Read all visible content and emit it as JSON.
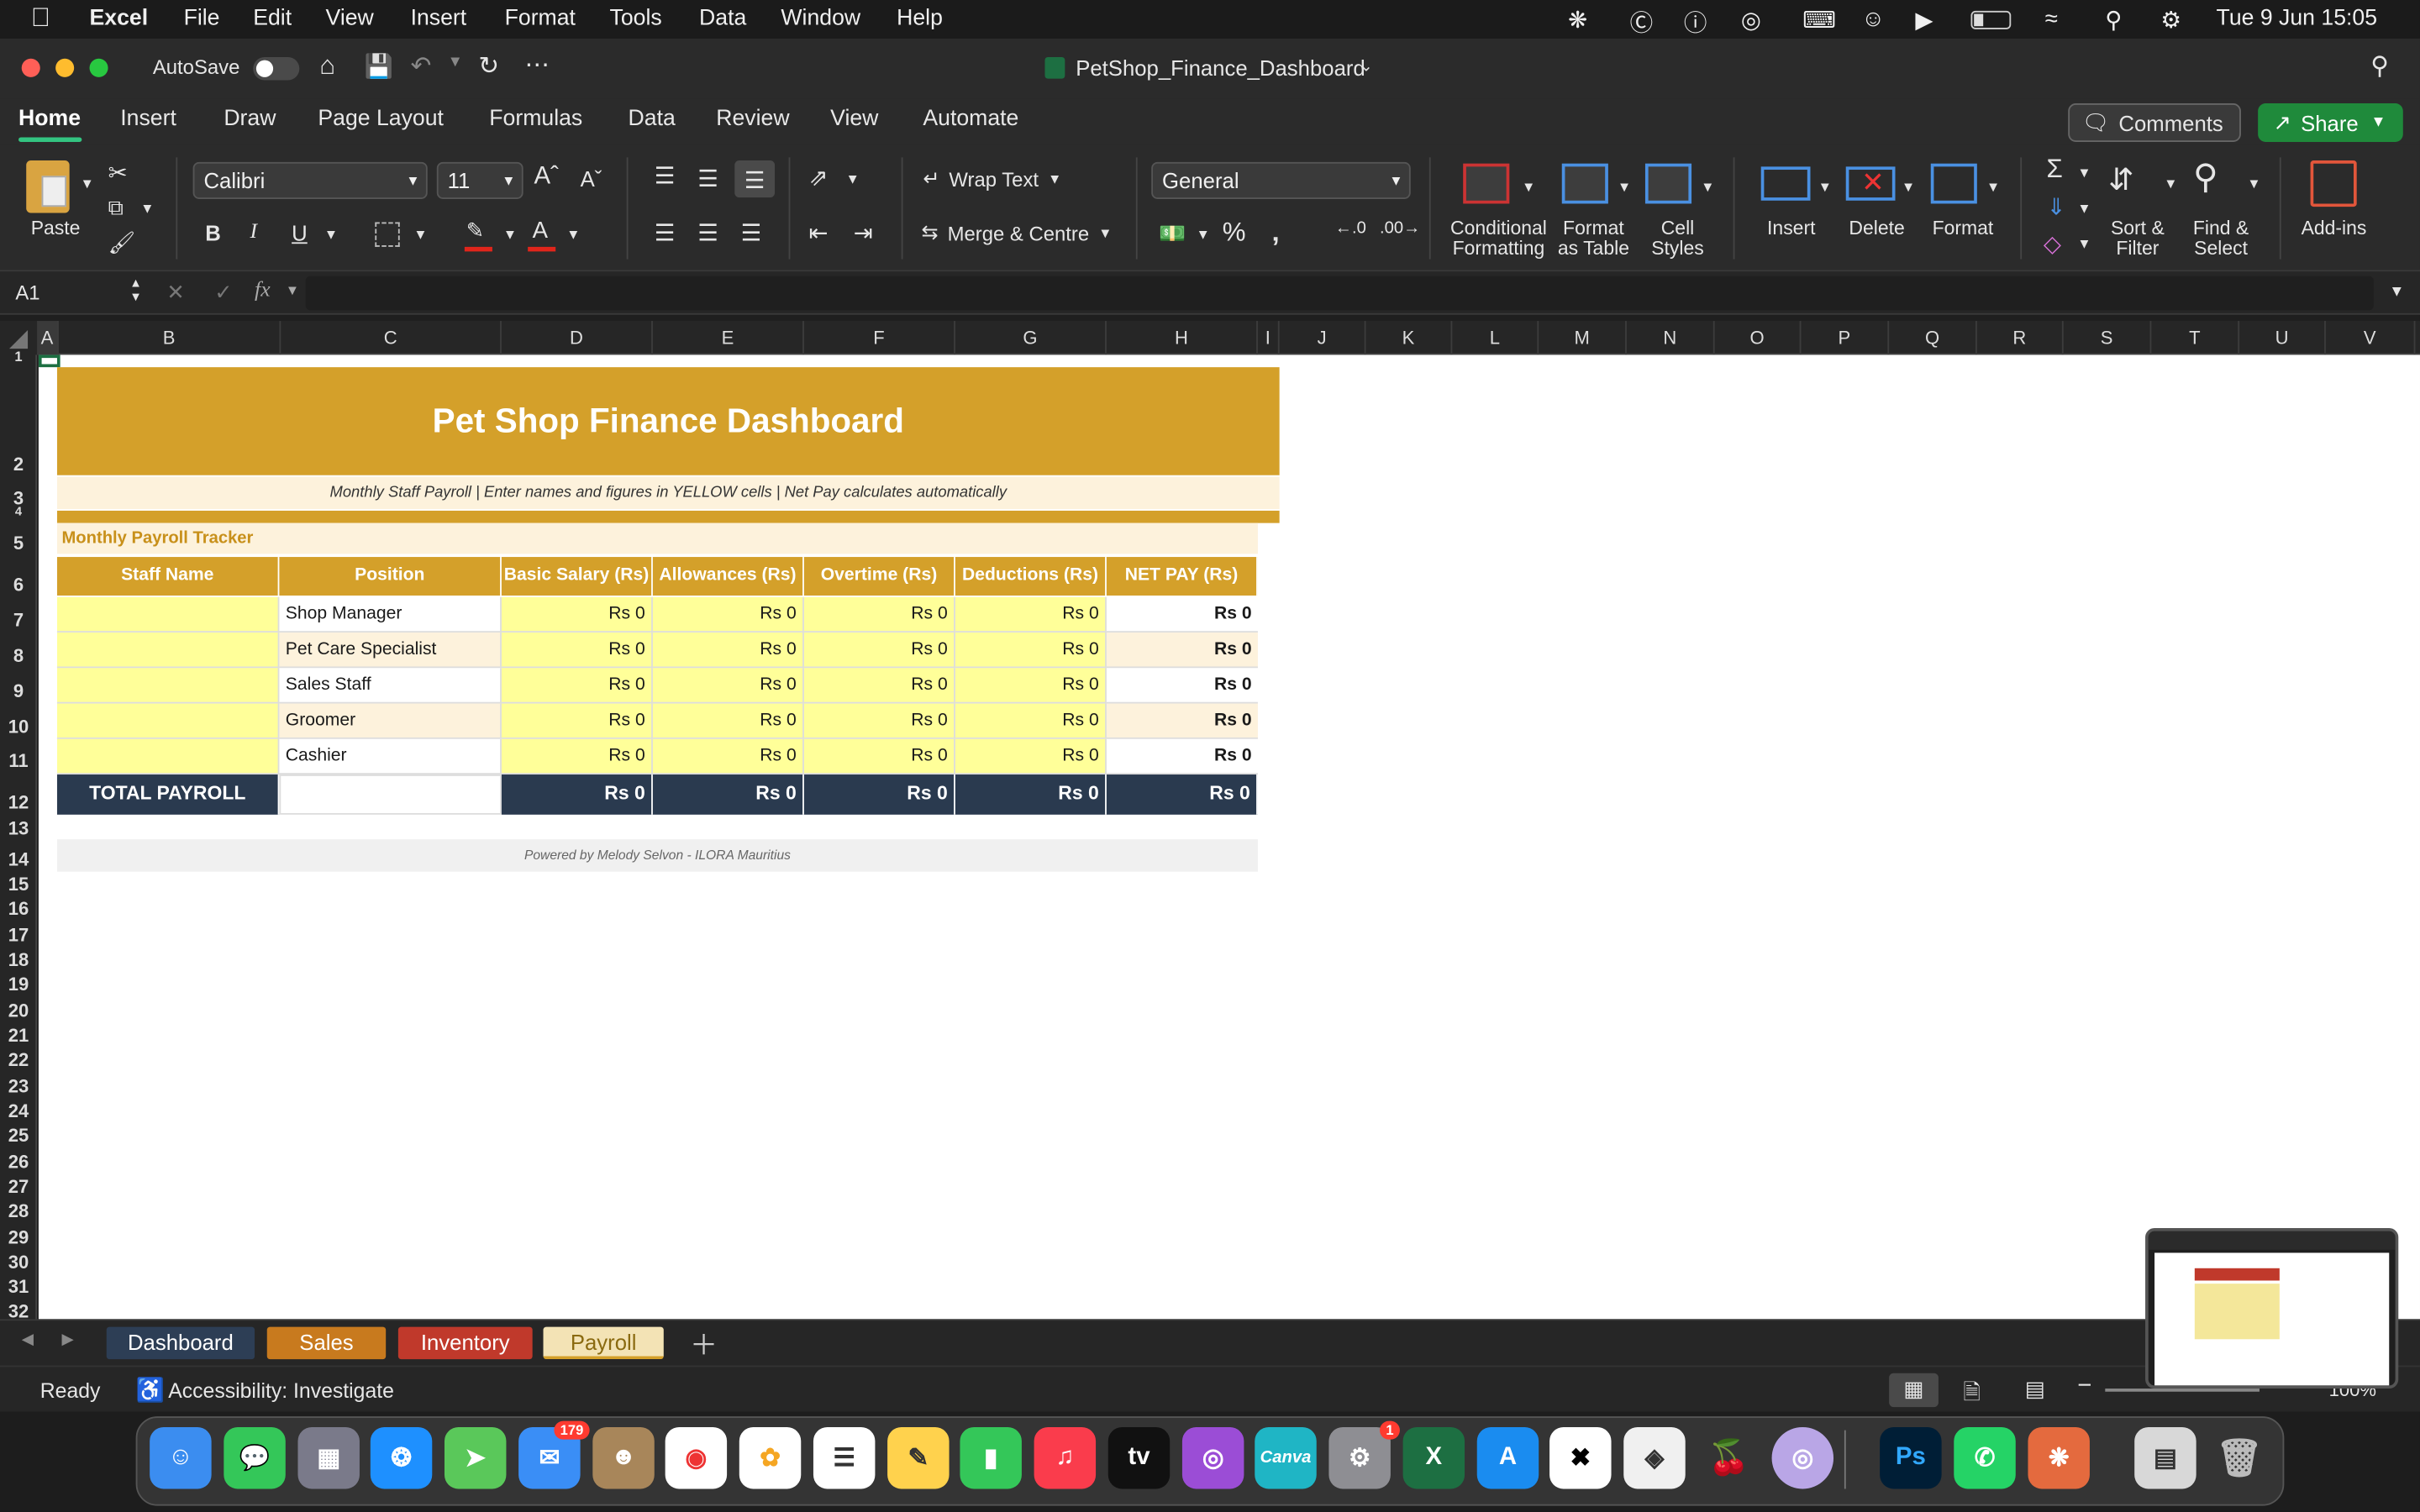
{
  "menubar": {
    "app": "Excel",
    "items": [
      "File",
      "Edit",
      "View",
      "Insert",
      "Format",
      "Tools",
      "Data",
      "Window",
      "Help"
    ],
    "clock": "Tue 9 Jun  15:05"
  },
  "titlebar": {
    "autosave": "AutoSave",
    "doc_title": "PetShop_Finance_Dashboard"
  },
  "ribbon_tabs": [
    "Home",
    "Insert",
    "Draw",
    "Page Layout",
    "Formulas",
    "Data",
    "Review",
    "View",
    "Automate"
  ],
  "ribbon_actions": {
    "comments": "Comments",
    "share": "Share"
  },
  "ribbon": {
    "paste": "Paste",
    "font_name": "Calibri",
    "font_size": "11",
    "wrap_text": "Wrap Text",
    "merge_centre": "Merge & Centre",
    "number_format": "General",
    "conditional_formatting": [
      "Conditional",
      "Formatting"
    ],
    "format_as_table": [
      "Format",
      "as Table"
    ],
    "cell_styles": [
      "Cell",
      "Styles"
    ],
    "insert": "Insert",
    "delete": "Delete",
    "format": "Format",
    "sort_filter": [
      "Sort &",
      "Filter"
    ],
    "find_select": [
      "Find &",
      "Select"
    ],
    "addins": "Add-ins",
    "bold": "B",
    "italic": "I",
    "underline": "U"
  },
  "formula_bar": {
    "name_box": "A1",
    "fx": "fx",
    "value": ""
  },
  "columns": [
    "A",
    "B",
    "C",
    "D",
    "E",
    "F",
    "G",
    "H",
    "I",
    "J",
    "K",
    "L",
    "M",
    "N",
    "O",
    "P",
    "Q",
    "R",
    "S",
    "T",
    "U",
    "V"
  ],
  "rows": [
    "1",
    "2",
    "3",
    "4",
    "5",
    "6",
    "7",
    "8",
    "9",
    "10",
    "11",
    "12",
    "13",
    "14",
    "15",
    "16",
    "17",
    "18",
    "19",
    "20",
    "21",
    "22",
    "23",
    "24",
    "25",
    "26",
    "27",
    "28",
    "29",
    "30",
    "31",
    "32"
  ],
  "sheet": {
    "title": "Pet Shop Finance Dashboard",
    "subtitle": "Monthly Staff Payroll  |  Enter names and figures in YELLOW cells  |  Net Pay calculates automatically",
    "section": "Monthly Payroll Tracker",
    "headers": [
      "Staff Name",
      "Position",
      "Basic Salary (Rs)",
      "Allowances (Rs)",
      "Overtime (Rs)",
      "Deductions (Rs)",
      "NET PAY (Rs)"
    ],
    "rows": [
      {
        "name": "",
        "position": "Shop Manager",
        "basic": "Rs 0",
        "allow": "Rs 0",
        "ot": "Rs 0",
        "ded": "Rs 0",
        "net": "Rs 0"
      },
      {
        "name": "",
        "position": "Pet Care Specialist",
        "basic": "Rs 0",
        "allow": "Rs 0",
        "ot": "Rs 0",
        "ded": "Rs 0",
        "net": "Rs 0"
      },
      {
        "name": "",
        "position": "Sales Staff",
        "basic": "Rs 0",
        "allow": "Rs 0",
        "ot": "Rs 0",
        "ded": "Rs 0",
        "net": "Rs 0"
      },
      {
        "name": "",
        "position": "Groomer",
        "basic": "Rs 0",
        "allow": "Rs 0",
        "ot": "Rs 0",
        "ded": "Rs 0",
        "net": "Rs 0"
      },
      {
        "name": "",
        "position": "Cashier",
        "basic": "Rs 0",
        "allow": "Rs 0",
        "ot": "Rs 0",
        "ded": "Rs 0",
        "net": "Rs 0"
      }
    ],
    "total": {
      "label": "TOTAL PAYROLL",
      "basic": "Rs 0",
      "allow": "Rs 0",
      "ot": "Rs 0",
      "ded": "Rs 0",
      "net": "Rs 0"
    },
    "footer": "Powered by Melody Selvon  -  ILORA Mauritius"
  },
  "sheet_tabs": [
    {
      "label": "Dashboard",
      "color": "#2d3e55",
      "text": "#ffffff"
    },
    {
      "label": "Sales",
      "color": "#c87a1e",
      "text": "#ffffff"
    },
    {
      "label": "Inventory",
      "color": "#c0392b",
      "text": "#ffffff"
    },
    {
      "label": "Payroll",
      "color": "#f3e3b5",
      "text": "#8a6a10"
    }
  ],
  "status": {
    "ready": "Ready",
    "accessibility": "Accessibility: Investigate",
    "zoom": "100%"
  },
  "dock": {
    "mail_badge": "179",
    "settings_badge": "1",
    "canva": "Canva",
    "ps": "Ps"
  },
  "colors": {
    "gold": "#d4a02a",
    "navy": "#2a3a4f",
    "yellow": "#ffff99",
    "cream": "#fdf2dc",
    "share_green": "#1f8a3b"
  }
}
